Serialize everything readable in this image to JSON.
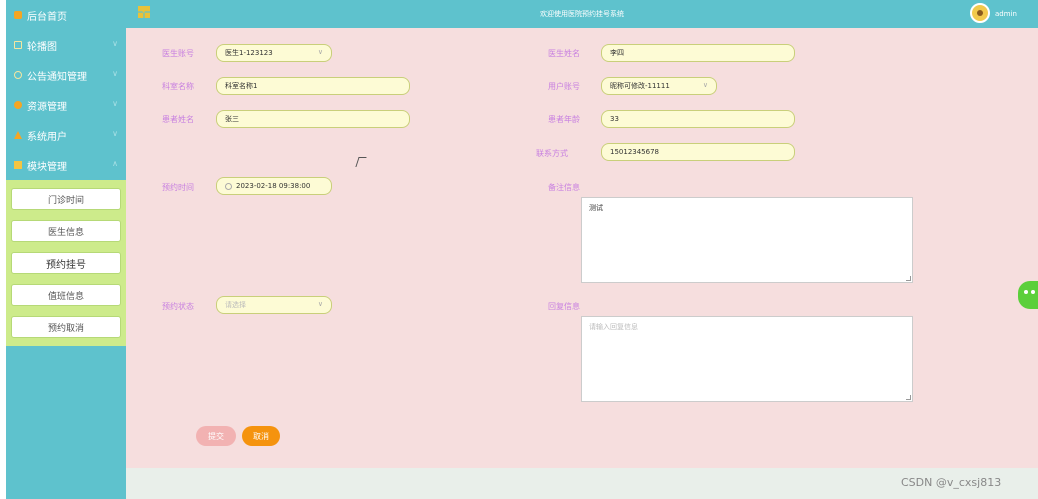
{
  "header": {
    "title": "欢迎使用医院预约挂号系统",
    "user": "admin"
  },
  "sidebar": {
    "items": [
      {
        "label": "后台首页",
        "icon": "home-icon"
      },
      {
        "label": "轮播图",
        "icon": "image-icon"
      },
      {
        "label": "公告通知管理",
        "icon": "clock-icon"
      },
      {
        "label": "资源管理",
        "icon": "coin-icon"
      },
      {
        "label": "系统用户",
        "icon": "user-icon"
      },
      {
        "label": "模块管理",
        "icon": "module-icon"
      }
    ],
    "submenu": [
      "门诊时间",
      "医生信息",
      "预约挂号",
      "值班信息",
      "预约取消"
    ]
  },
  "form": {
    "doctor_account": {
      "label": "医生账号",
      "value": "医生1-123123"
    },
    "doctor_name": {
      "label": "医生姓名",
      "value": "李四"
    },
    "dept_name": {
      "label": "科室名称",
      "value": "科室名称1"
    },
    "user_account": {
      "label": "用户账号",
      "value": "昵称可修改-11111"
    },
    "patient_name": {
      "label": "患者姓名",
      "value": "张三"
    },
    "patient_age": {
      "label": "患者年龄",
      "value": "33"
    },
    "contact": {
      "label": "联系方式",
      "value": "15012345678"
    },
    "appt_time": {
      "label": "预约时间",
      "value": "2023-02-18 09:38:00"
    },
    "remarks": {
      "label": "备注信息",
      "value": "测试"
    },
    "appt_status": {
      "label": "预约状态",
      "placeholder": "请选择"
    },
    "reply": {
      "label": "回复信息",
      "placeholder": "请输入回复信息"
    },
    "submit_label": "提交",
    "cancel_label": "取消"
  },
  "watermark": "CSDN @v_cxsj813",
  "colors": {
    "sidebar": "#5ec2cd",
    "submenu_bg": "#cdeb8b",
    "main_bg": "#f6dede",
    "label": "#c880e0",
    "field_bg": "#fdfbd5",
    "cancel_btn": "#f5930e",
    "submit_btn": "#f2b2b2"
  }
}
